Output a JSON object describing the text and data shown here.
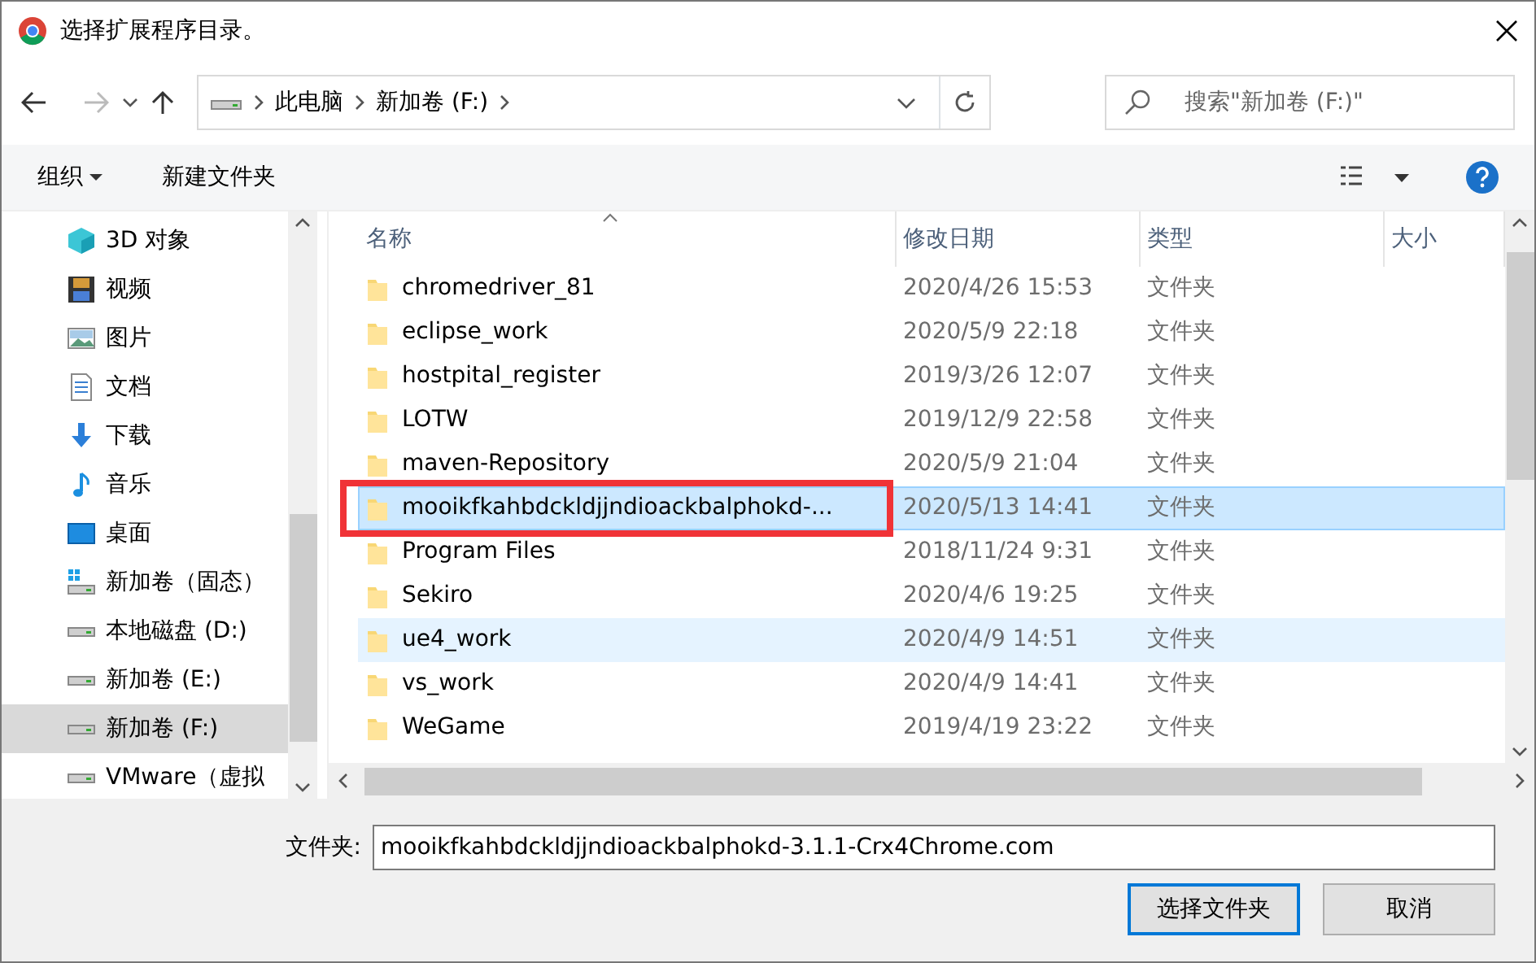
{
  "window": {
    "title": "选择扩展程序目录。"
  },
  "address": {
    "path": [
      {
        "label": "此电脑"
      },
      {
        "label": "新加卷 (F:)"
      }
    ]
  },
  "search": {
    "placeholder": "搜索\"新加卷 (F:)\""
  },
  "toolbar": {
    "organize": "组织",
    "new_folder": "新建文件夹"
  },
  "sidebar": {
    "items": [
      {
        "label": "3D 对象",
        "kind": "cube",
        "selected": false
      },
      {
        "label": "视频",
        "kind": "video",
        "selected": false
      },
      {
        "label": "图片",
        "kind": "picture",
        "selected": false
      },
      {
        "label": "文档",
        "kind": "document",
        "selected": false
      },
      {
        "label": "下载",
        "kind": "download",
        "selected": false
      },
      {
        "label": "音乐",
        "kind": "music",
        "selected": false
      },
      {
        "label": "桌面",
        "kind": "desktop",
        "selected": false
      },
      {
        "label": "新加卷（固态）",
        "kind": "system-drive",
        "selected": false
      },
      {
        "label": "本地磁盘 (D:)",
        "kind": "drive",
        "selected": false
      },
      {
        "label": "新加卷 (E:)",
        "kind": "drive",
        "selected": false
      },
      {
        "label": "新加卷 (F:)",
        "kind": "drive",
        "selected": true
      },
      {
        "label": "VMware（虚拟",
        "kind": "drive",
        "selected": false
      }
    ]
  },
  "table": {
    "columns": [
      "名称",
      "修改日期",
      "类型",
      "大小"
    ],
    "rows": [
      {
        "name": "chromedriver_81",
        "date": "2020/4/26 15:53",
        "type": "文件夹",
        "selected": false,
        "hovered": false,
        "outlined": false
      },
      {
        "name": "eclipse_work",
        "date": "2020/5/9 22:18",
        "type": "文件夹",
        "selected": false,
        "hovered": false,
        "outlined": false
      },
      {
        "name": "hostpital_register",
        "date": "2019/3/26 12:07",
        "type": "文件夹",
        "selected": false,
        "hovered": false,
        "outlined": false
      },
      {
        "name": "LOTW",
        "date": "2019/12/9 22:58",
        "type": "文件夹",
        "selected": false,
        "hovered": false,
        "outlined": false
      },
      {
        "name": "maven-Repository",
        "date": "2020/5/9 21:04",
        "type": "文件夹",
        "selected": false,
        "hovered": false,
        "outlined": false
      },
      {
        "name": "mooikfkahbdckldjjndioackbalphokd-...",
        "date": "2020/5/13 14:41",
        "type": "文件夹",
        "selected": true,
        "hovered": false,
        "outlined": true
      },
      {
        "name": "Program Files",
        "date": "2018/11/24 9:31",
        "type": "文件夹",
        "selected": false,
        "hovered": false,
        "outlined": false
      },
      {
        "name": "Sekiro",
        "date": "2020/4/6 19:25",
        "type": "文件夹",
        "selected": false,
        "hovered": false,
        "outlined": false
      },
      {
        "name": "ue4_work",
        "date": "2020/4/9 14:51",
        "type": "文件夹",
        "selected": false,
        "hovered": true,
        "outlined": false
      },
      {
        "name": "vs_work",
        "date": "2020/4/9 14:41",
        "type": "文件夹",
        "selected": false,
        "hovered": false,
        "outlined": false
      },
      {
        "name": "WeGame",
        "date": "2019/4/19 23:22",
        "type": "文件夹",
        "selected": false,
        "hovered": false,
        "outlined": false
      }
    ]
  },
  "footer": {
    "label": "文件夹:",
    "value": "mooikfkahbdckldjjndioackbalphokd-3.1.1-Crx4Chrome.com",
    "buttons": [
      {
        "label": "选择文件夹",
        "primary": true
      },
      {
        "label": "取消",
        "primary": false
      }
    ]
  }
}
